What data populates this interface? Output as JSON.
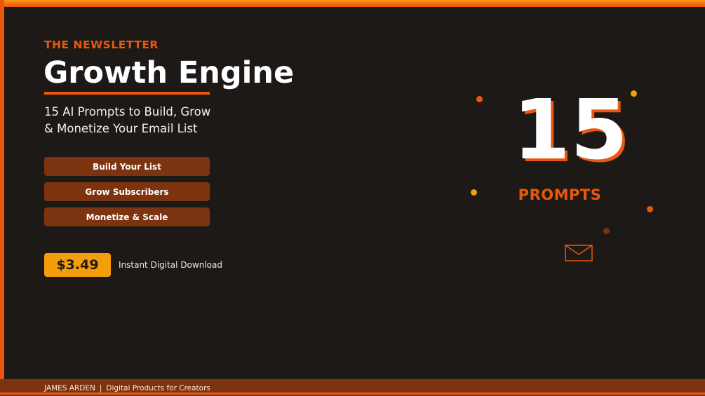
{
  "header": {
    "eyebrow": "THE NEWSLETTER",
    "title": "Growth Engine",
    "subtitle_line1": "15 AI Prompts to Build, Grow",
    "subtitle_line2": "& Monetize Your Email List"
  },
  "features": [
    {
      "label": "Build Your List"
    },
    {
      "label": "Grow Subscribers"
    },
    {
      "label": "Monetize & Scale"
    }
  ],
  "offer": {
    "price": "$3.49",
    "note": "Instant Digital Download"
  },
  "hero": {
    "number": "15",
    "label": "PROMPTS",
    "icon": "envelope-icon"
  },
  "footer": {
    "author": "JAMES ARDEN",
    "separator": "|",
    "tagline": "Digital Products for Creators"
  },
  "colors": {
    "background": "#1c1917",
    "accent": "#ea580c",
    "accent_light": "#f59e0b",
    "pill": "#7c3410",
    "text": "#ffffff"
  }
}
